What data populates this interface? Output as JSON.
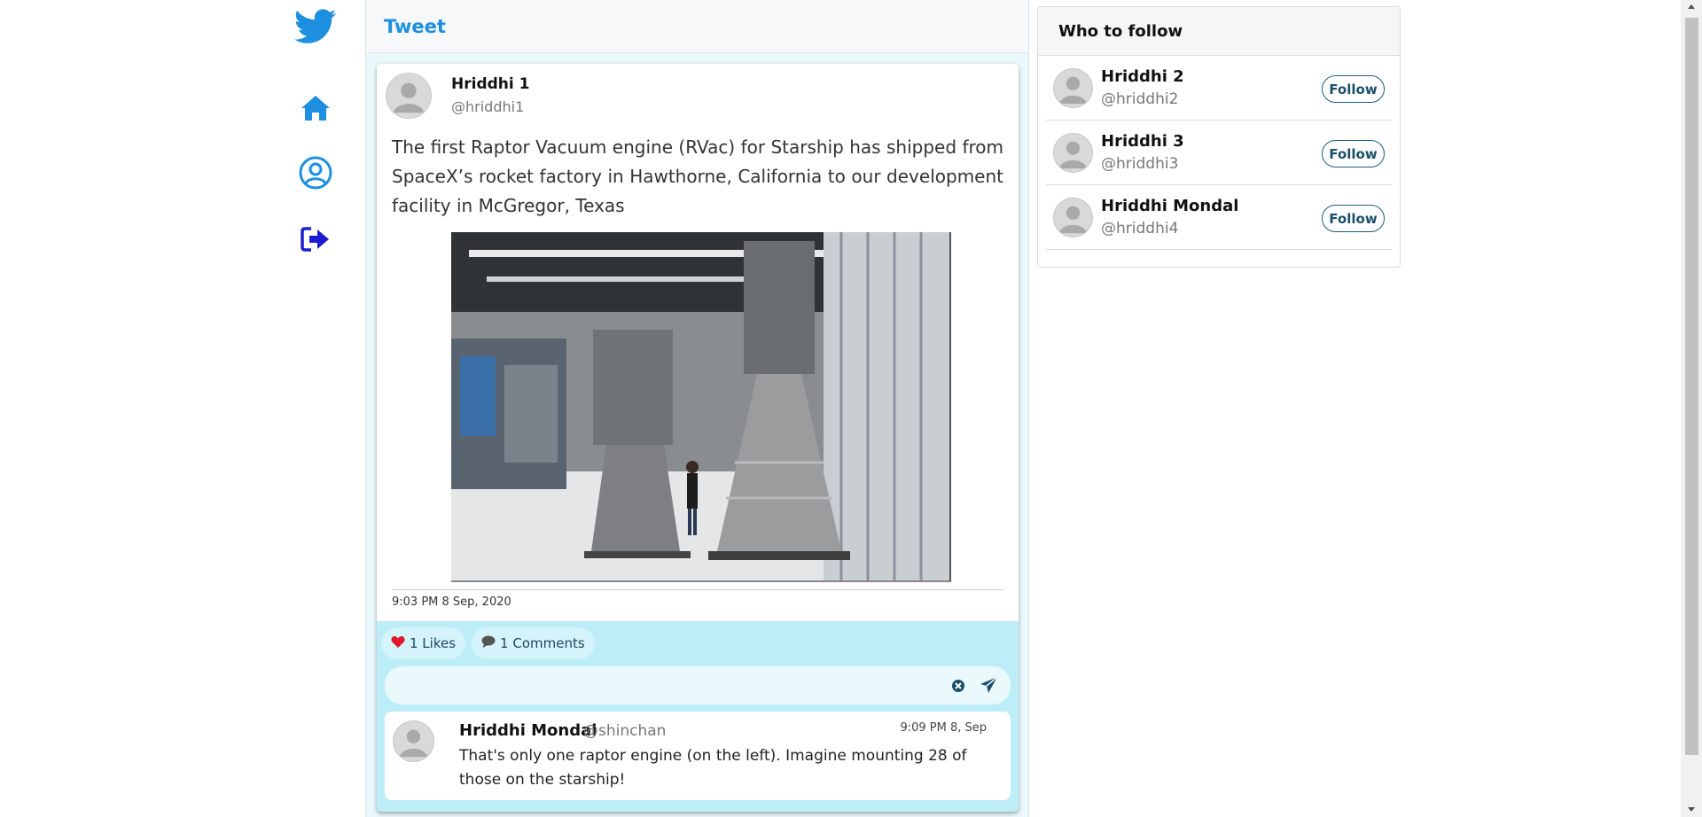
{
  "nav": {
    "logo_icon": "twitter-bird-icon",
    "items": [
      {
        "icon": "home-icon"
      },
      {
        "icon": "user-profile-icon"
      },
      {
        "icon": "logout-icon"
      }
    ],
    "accent_color": "#1d8fe0",
    "logout_color": "#1c1ccf"
  },
  "header": {
    "title": "Tweet"
  },
  "tweet": {
    "author_name": "Hriddhi 1",
    "author_handle": "@hriddhi1",
    "text": "The first Raptor Vacuum engine (RVac) for Starship has shipped from SpaceX’s rocket factory in Hawthorne, California to our development facility in McGregor, Texas",
    "timestamp": "9:03 PM 8 Sep, 2020",
    "likes_label": "1 Likes",
    "comments_label": "1 Comments",
    "like_color": "#e0162b"
  },
  "comment_input": {
    "placeholder": "",
    "value": ""
  },
  "replies": [
    {
      "author_name": "Hriddhi Mondal",
      "author_handle": "@shinchan",
      "time": "9:09 PM 8, Sep",
      "text": "That's only one raptor engine (on the left). Imagine mounting 28 of those on the starship!"
    }
  ],
  "who_to_follow": {
    "title": "Who to follow",
    "users": [
      {
        "name": "Hriddhi 2",
        "handle": "@hriddhi2",
        "button": "Follow"
      },
      {
        "name": "Hriddhi 3",
        "handle": "@hriddhi3",
        "button": "Follow"
      },
      {
        "name": "Hriddhi Mondal",
        "handle": "@hriddhi4",
        "button": "Follow"
      }
    ]
  }
}
